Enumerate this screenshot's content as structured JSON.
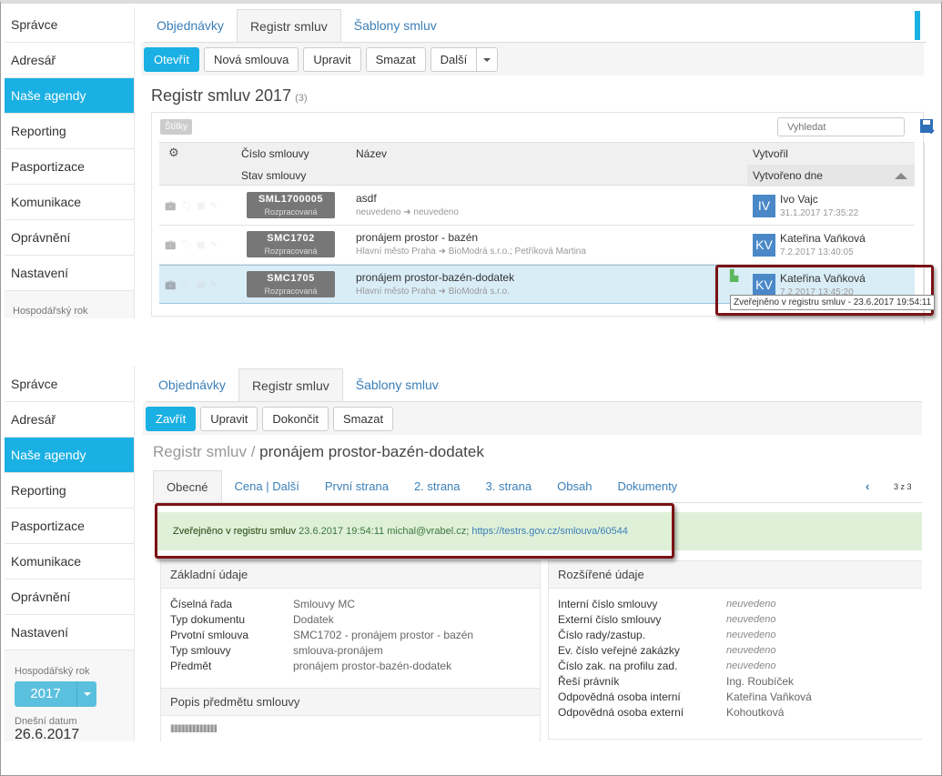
{
  "sidebar_items": [
    "Správce",
    "Adresář",
    "Naše agendy",
    "Reporting",
    "Pasportizace",
    "Komunikace",
    "Oprávnění",
    "Nastavení"
  ],
  "sidebar_active": 2,
  "fiscal_year_label": "Hospodářský rok",
  "fiscal_year_value": "2017",
  "today_label": "Dnešní datum",
  "today_value": "26.6.2017",
  "tabs": [
    "Objednávky",
    "Registr smluv",
    "Šablony smluv"
  ],
  "top": {
    "toolbar": {
      "open": "Otevřít",
      "new": "Nová smlouva",
      "edit": "Upravit",
      "delete": "Smazat",
      "more": "Další"
    },
    "title": "Registr smluv 2017",
    "count": "(3)",
    "tags_label": "Štítky",
    "search_placeholder": "Vyhledat",
    "columns": {
      "number": "Číslo smlouvy",
      "status": "Stav smlouvy",
      "name": "Název",
      "created_by": "Vytvořil",
      "created_on": "Vytvořeno dne"
    },
    "rows": [
      {
        "code": "SML1700005",
        "status": "Rozpracovaná",
        "name": "asdf",
        "parties": "neuvedeno ➜ neuvedeno",
        "initials": "IV",
        "user": "Ivo Vajc",
        "date": "31.1.2017 17:35:22"
      },
      {
        "code": "SMC1702",
        "status": "Rozpracovaná",
        "name": "pronájem prostor - bazén",
        "parties": "Hlavní město Praha ➜ BioModrá s.r.o.; Petříková Martina",
        "initials": "KV",
        "user": "Kateřina Vaňková",
        "date": "7.2.2017 13:40:05"
      },
      {
        "code": "SMC1705",
        "status": "Rozpracovaná",
        "name": "pronájem prostor-bazén-dodatek",
        "parties": "Hlavní město Praha ➜ BioModrá s.r.o.",
        "initials": "KV",
        "user": "Kateřina Vaňková",
        "date": "7.2.2017 13:45:20"
      }
    ],
    "tooltip": "Zveřejněno v registru smluv - 23.6.2017 19:54:11"
  },
  "bottom": {
    "toolbar": {
      "close": "Zavřít",
      "edit": "Upravit",
      "finish": "Dokončit",
      "delete": "Smazat"
    },
    "breadcrumb_root": "Registr smluv",
    "breadcrumb_sep": "/",
    "breadcrumb_current": "pronájem prostor-bazén-dodatek",
    "subtabs": [
      "Obecné",
      "Cena | Další",
      "První strana",
      "2. strana",
      "3. strana",
      "Obsah",
      "Dokumenty"
    ],
    "pager": "3 z 3",
    "banner": {
      "label": "Zveřejněno v registru smluv",
      "datetime": "23.6.2017 19:54:11",
      "email": "michal@vrabel.cz;",
      "link": "https://testrs.gov.cz/smlouva/60544"
    },
    "basic": {
      "title": "Základní údaje",
      "fields": [
        [
          "Číselná řada",
          "Smlouvy MC"
        ],
        [
          "Typ dokumentu",
          "Dodatek"
        ],
        [
          "Prvotní smlouva",
          "SMC1702 - pronájem prostor - bazén"
        ],
        [
          "Typ smlouvy",
          "smlouva-pronájem"
        ],
        [
          "Předmět",
          "pronájem prostor-bazén-dodatek"
        ]
      ]
    },
    "desc": {
      "title": "Popis předmětu smlouvy",
      "text": "||||||||||||||||||||||||||||||||||||||"
    },
    "extended": {
      "title": "Rozšířené údaje",
      "fields": [
        [
          "Interní číslo smlouvy",
          "neuvedeno"
        ],
        [
          "Externí číslo smlouvy",
          "neuvedeno"
        ],
        [
          "Číslo rady/zastup.",
          "neuvedeno"
        ],
        [
          "Ev. číslo veřejné zakázky",
          "neuvedeno"
        ],
        [
          "Číslo zak. na profilu zad.",
          "neuvedeno"
        ],
        [
          "Řeší právník",
          "Ing. Roubíček"
        ],
        [
          "Odpovědná osoba interní",
          "Kateřina Vaňková"
        ],
        [
          "Odpovědná osoba externí",
          "Kohoutková"
        ]
      ]
    }
  }
}
